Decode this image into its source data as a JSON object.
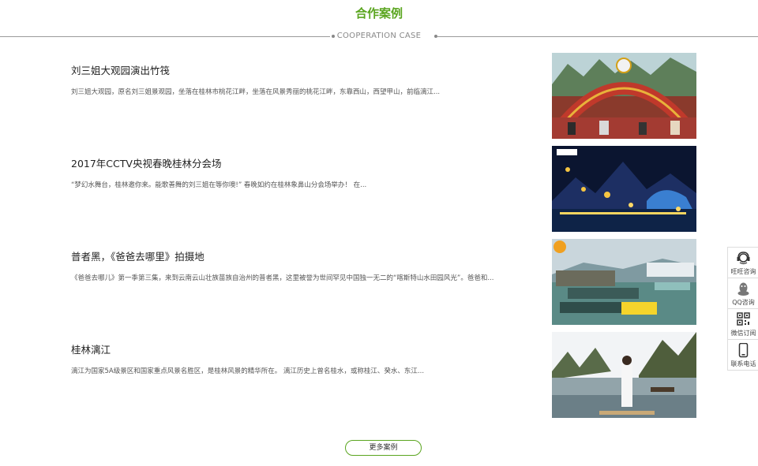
{
  "header": {
    "title_cn": "合作案例",
    "title_en": "COOPERATION CASE",
    "accent_color": "#5aa51f"
  },
  "cases": [
    {
      "title": "刘三姐大观园演出竹筏",
      "desc": "刘三姐大观园，原名刘三姐景观园，坐落在桂林市桃花江畔，坐落在风景秀丽的桃花江畔，东靠西山，西望甲山，前临漓江...",
      "image_icon": "liusanjie-park-gate-photo"
    },
    {
      "title": "2017年CCTV央视春晚桂林分会场",
      "desc": "“梦幻水舞台，桂林邀你来。能歌善舞的刘三姐在等你噢!” 春晚如约在桂林象鼻山分会场举办！ 在...",
      "image_icon": "cctv-gala-stage-photo"
    },
    {
      "title": "普者黑，《爸爸去哪里》拍摄地",
      "desc": "《爸爸去哪儿》第一季第三集，来到云南云山壮族苗族自治州的普者黑，这里被誉为世间罕见中国独一无二的“喀斯特山水田园风光”。爸爸和...",
      "image_icon": "bamboo-rafts-photo"
    },
    {
      "title": "桂林漓江",
      "desc": "漓江为国家5A级景区和国家重点风景名胜区，是桂林风景的精华所在。 漓江历史上曾名桂水，或称桂江、癸水、东江...",
      "image_icon": "li-river-photo"
    }
  ],
  "more_button": {
    "label": "更多案例"
  },
  "side_bar": {
    "items": [
      {
        "label": "旺旺咨询",
        "icon": "headset-icon"
      },
      {
        "label": "QQ咨询",
        "icon": "qq-penguin-icon"
      },
      {
        "label": "微信订阅",
        "icon": "qr-code-icon"
      },
      {
        "label": "联系电话",
        "icon": "phone-icon"
      }
    ]
  }
}
